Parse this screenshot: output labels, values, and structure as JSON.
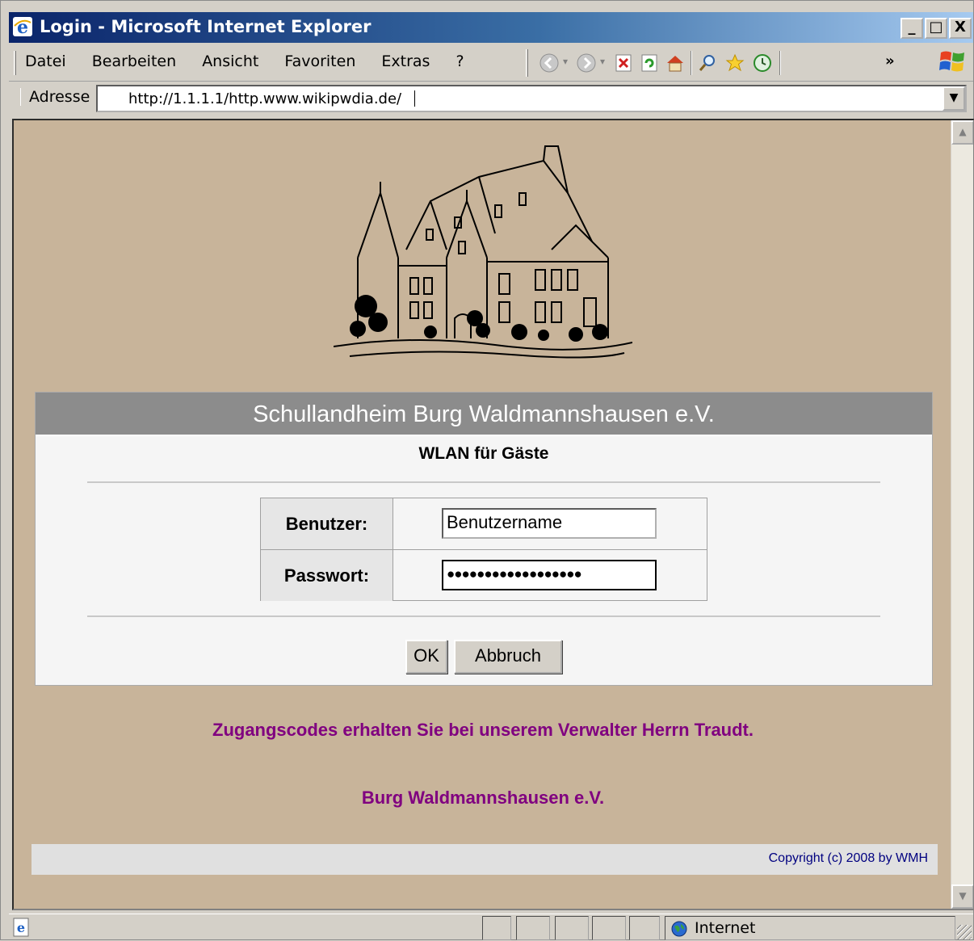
{
  "window": {
    "title": "Login - Microsoft Internet Explorer",
    "controls": [
      "_",
      "□",
      "X"
    ]
  },
  "menu": {
    "items": [
      "Datei",
      "Bearbeiten",
      "Ansicht",
      "Favoriten",
      "Extras",
      "?"
    ]
  },
  "toolbar": {
    "icons": [
      "back-icon",
      "forward-icon",
      "stop-icon",
      "refresh-icon",
      "home-icon",
      "search-icon",
      "favorites-icon",
      "history-icon"
    ],
    "overflow": "»"
  },
  "address": {
    "label": "Adresse",
    "value": "http://1.1.1.1/http.www.wikipwdia.de/"
  },
  "page": {
    "header": "Schullandheim Burg Waldmannshausen e.V.",
    "subtitle": "WLAN für Gäste",
    "user_label": "Benutzer:",
    "user_value": "Benutzername",
    "pass_label": "Passwort:",
    "pass_value": "●●●●●●●●●●●●●●●●●●",
    "ok_label": "OK",
    "cancel_label": "Abbruch",
    "info": "Zugangscodes erhalten Sie bei unserem Verwalter Herrn Traudt.",
    "org": "Burg Waldmannshausen e.V.",
    "copyright": "Copyright (c) 2008 by WMH"
  },
  "status": {
    "zone": "Internet"
  },
  "colors": {
    "page_bg": "#c8b49a",
    "header_bg": "#8c8c8c",
    "info_text": "#800080",
    "copyright_text": "#000080",
    "titlebar_start": "#0a246a",
    "titlebar_end": "#a6caf0"
  }
}
